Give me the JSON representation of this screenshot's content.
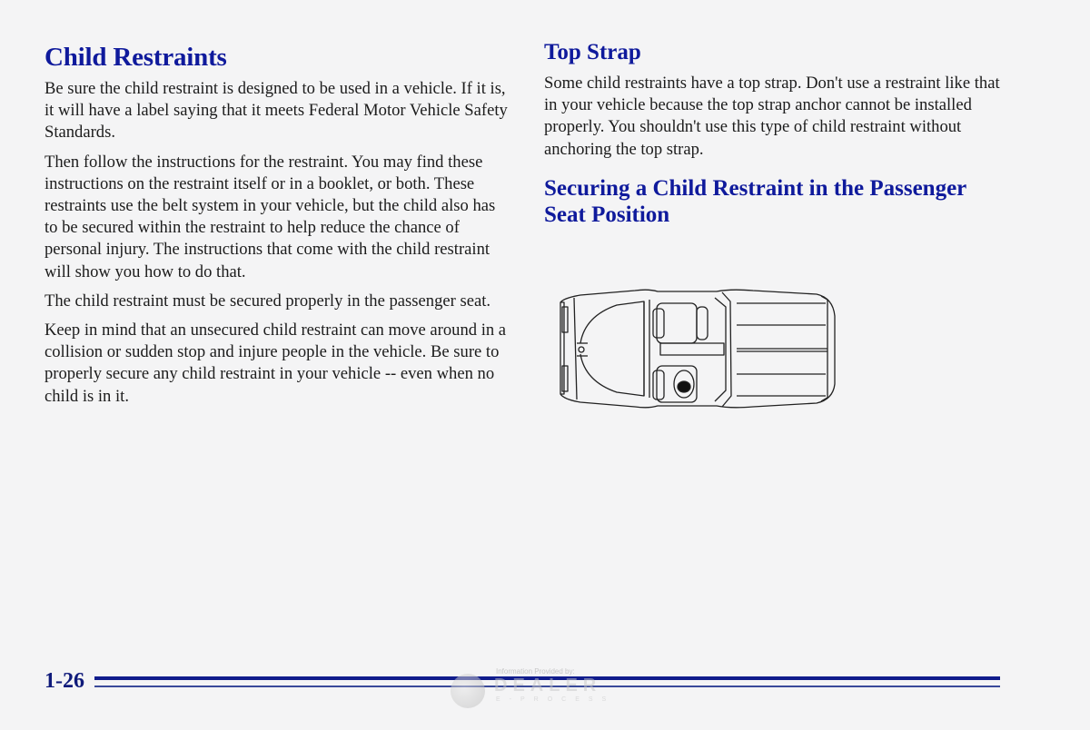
{
  "left_column": {
    "title": "Child Restraints",
    "paragraphs": [
      "Be sure the child restraint is designed to be used in a vehicle. If it is, it will have a label saying that it meets Federal Motor Vehicle Safety Standards.",
      "Then follow the instructions for the restraint. You may find these instructions on the restraint itself or in a booklet, or both. These restraints use the belt system in your vehicle, but the child also has to be secured within the restraint to help reduce the chance of personal injury. The instructions that come with the child restraint will show you how to do that.",
      "The child restraint must be secured properly in the passenger seat.",
      "Keep in mind that an unsecured child restraint can move around in a collision or sudden stop and injure people in the vehicle. Be sure to properly secure any child restraint in your vehicle -- even when no child is in it."
    ]
  },
  "right_column": {
    "top_strap_heading": "Top Strap",
    "top_strap_text": "Some child restraints have a top strap. Don't use a restraint like that in your vehicle because the top strap anchor cannot be installed properly. You shouldn't use this type of child restraint without anchoring the top strap.",
    "securing_heading": "Securing a Child Restraint in the Passenger Seat Position",
    "figure_description": "Top view of vehicle showing child restraint in passenger seat"
  },
  "footer": {
    "page_number": "1-26",
    "watermark_provided": "Information Provided by:",
    "watermark_brand": "DEALER",
    "watermark_sub": "E-PROCESS"
  },
  "colors": {
    "heading": "#0f1a9c",
    "rule": "#101c8c",
    "text": "#1c1c1c"
  }
}
